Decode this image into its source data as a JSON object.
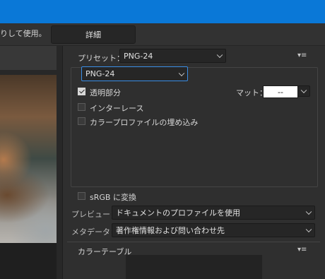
{
  "toolbar": {
    "hint_text": "りして使用。",
    "detail_button": "詳細"
  },
  "preset": {
    "label": "プリセット：",
    "value": "PNG-24"
  },
  "format": {
    "value": "PNG-24"
  },
  "options": {
    "transparency_label": "透明部分",
    "transparency_checked": true,
    "interlace_label": "インターレース",
    "embed_profile_label": "カラープロファイルの埋め込み",
    "matte_label": "マット：",
    "matte_value": "--"
  },
  "srgb": {
    "label": "sRGB に変換"
  },
  "preview": {
    "label": "プレビュー：",
    "value": "ドキュメントのプロファイルを使用"
  },
  "metadata": {
    "label": "メタデータ：",
    "value": "著作権情報および問い合わせ先"
  },
  "color_table": {
    "title": "カラーテーブル"
  },
  "colors": {
    "titlebar": "#0a78d7",
    "focus_border": "#3a8ee6"
  }
}
